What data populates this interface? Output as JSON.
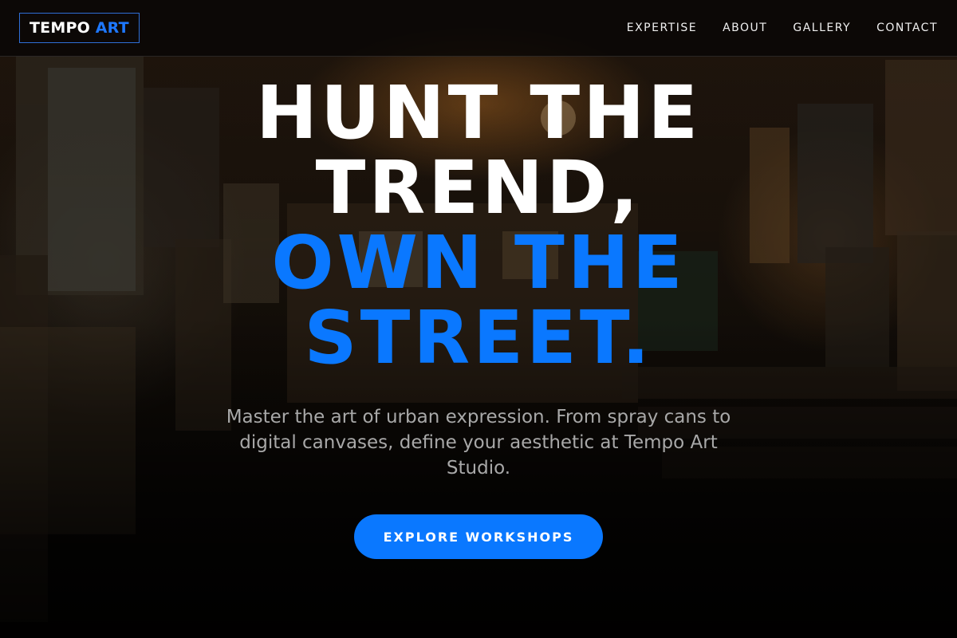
{
  "brand": {
    "logo_primary": "TEMPO",
    "logo_accent": "ART",
    "accent_color": "#0a78ff"
  },
  "nav": {
    "items": [
      {
        "label": "EXPERTISE"
      },
      {
        "label": "ABOUT"
      },
      {
        "label": "GALLERY"
      },
      {
        "label": "CONTACT"
      }
    ]
  },
  "hero": {
    "headline_lines": [
      {
        "text": "HUNT THE",
        "color": "#ffffff"
      },
      {
        "text": "TREND,",
        "color": "#ffffff"
      },
      {
        "text": "OWN THE",
        "color": "#0a78ff"
      },
      {
        "text": "STREET.",
        "color": "#0a78ff"
      }
    ],
    "subtext": "Master the art of urban expression. From spray cans to digital canvases, define your aesthetic at Tempo Art Studio.",
    "cta_label": "EXPLORE WORKSHOPS"
  },
  "background": {
    "image_subject": "dim art gallery storage room filled with paintings"
  }
}
